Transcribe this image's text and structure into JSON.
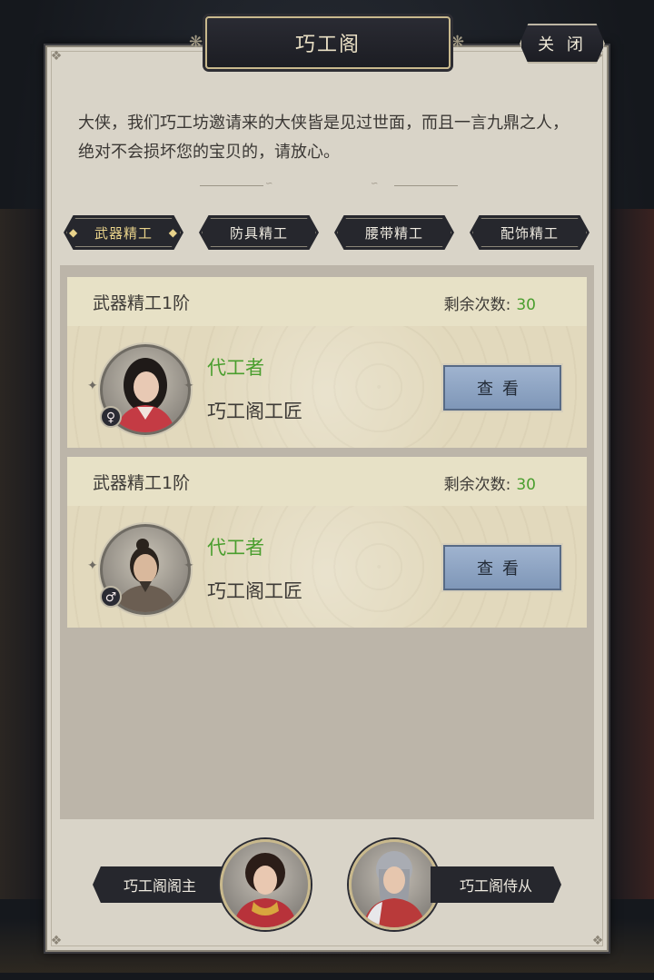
{
  "header": {
    "title": "巧工阁",
    "close_label": "关 闭"
  },
  "intro_text": "大侠，我们巧工坊邀请来的大侠皆是见过世面，而且一言九鼎之人，绝对不会损坏您的宝贝的，请放心。",
  "tabs": [
    {
      "label": "武器精工",
      "active": true
    },
    {
      "label": "防具精工",
      "active": false
    },
    {
      "label": "腰带精工",
      "active": false
    },
    {
      "label": "配饰精工",
      "active": false
    }
  ],
  "cards": [
    {
      "title": "武器精工1阶",
      "remain_label": "剩余次数:",
      "remain_value": "30",
      "role": "代工者",
      "name": "巧工阁工匠",
      "gender": "♀",
      "button": "查看"
    },
    {
      "title": "武器精工1阶",
      "remain_label": "剩余次数:",
      "remain_value": "30",
      "role": "代工者",
      "name": "巧工阁工匠",
      "gender": "♂",
      "button": "查看"
    }
  ],
  "npcs": [
    {
      "label": "巧工阁阁主"
    },
    {
      "label": "巧工阁侍从"
    }
  ],
  "colors": {
    "green": "#4a9e2e",
    "gold": "#e8d28a",
    "button_blue": "#8ea5c4"
  }
}
